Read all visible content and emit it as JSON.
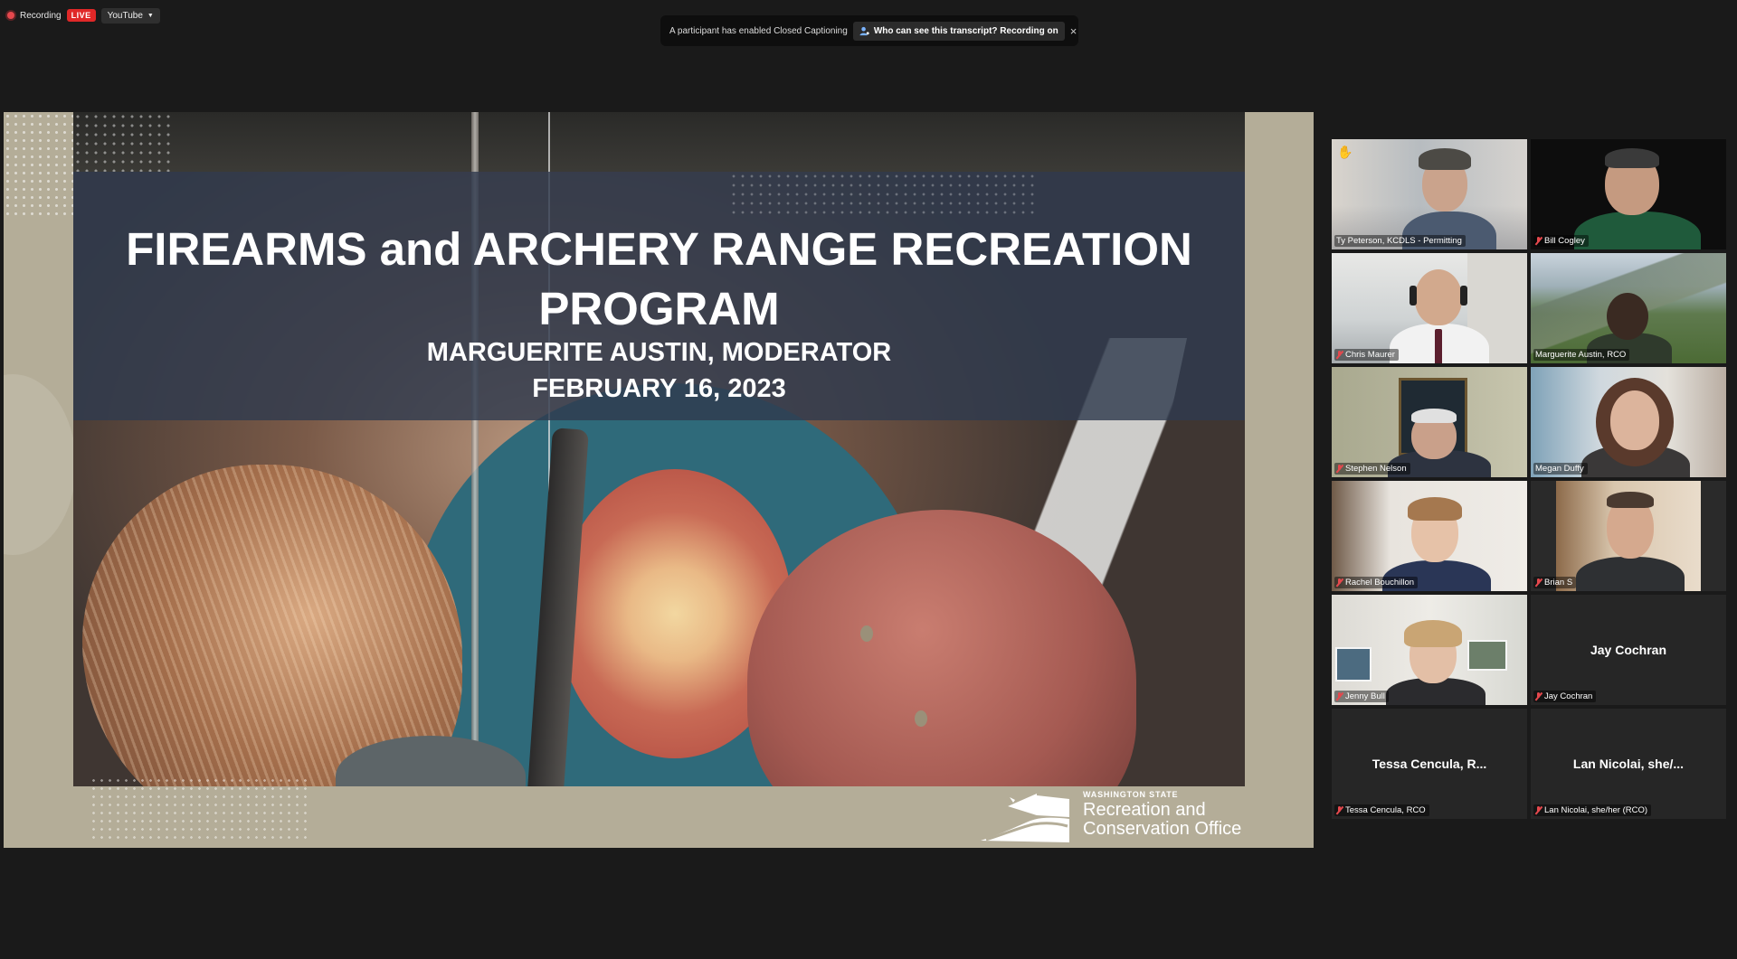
{
  "topbar": {
    "recording_label": "Recording",
    "live_label": "LIVE",
    "stream_target": "YouTube"
  },
  "cc_banner": {
    "message": "A participant has enabled Closed Captioning",
    "link": "Who can see this transcript? Recording on",
    "close": "×"
  },
  "slide": {
    "title": "FIREARMS and ARCHERY RANGE RECREATION PROGRAM",
    "subtitle": "MARGUERITE AUSTIN, MODERATOR",
    "date": "FEBRUARY 16, 2023",
    "logo": {
      "small": "WASHINGTON STATE",
      "line1": "Recreation and",
      "line2": "Conservation Office"
    }
  },
  "participants": [
    {
      "name": "Ty Peterson, KCDLS - Permitting",
      "muted": false,
      "hand_raised": true,
      "video": true,
      "speaking": false
    },
    {
      "name": "Bill Cogley",
      "muted": true,
      "hand_raised": false,
      "video": true,
      "speaking": false
    },
    {
      "name": "Chris Maurer",
      "muted": true,
      "hand_raised": false,
      "video": true,
      "speaking": false
    },
    {
      "name": "Marguerite Austin, RCO",
      "muted": false,
      "hand_raised": false,
      "video": true,
      "speaking": true
    },
    {
      "name": "Stephen Nelson",
      "muted": true,
      "hand_raised": false,
      "video": true,
      "speaking": false
    },
    {
      "name": "Megan Duffy",
      "muted": false,
      "hand_raised": false,
      "video": true,
      "speaking": false
    },
    {
      "name": "Rachel Bouchillon",
      "muted": true,
      "hand_raised": false,
      "video": true,
      "speaking": false
    },
    {
      "name": "Brian S",
      "muted": true,
      "hand_raised": false,
      "video": true,
      "speaking": false
    },
    {
      "name": "Jenny Bull",
      "muted": true,
      "hand_raised": false,
      "video": true,
      "speaking": false
    },
    {
      "name": "Jay Cochran",
      "display_name": "Jay Cochran",
      "muted": true,
      "hand_raised": false,
      "video": false,
      "speaking": false
    },
    {
      "name": "Tessa Cencula, RCO",
      "display_name": "Tessa Cencula, R...",
      "muted": true,
      "hand_raised": false,
      "video": false,
      "speaking": false
    },
    {
      "name": "Lan Nicolai, she/her (RCO)",
      "display_name": "Lan Nicolai, she/...",
      "muted": true,
      "hand_raised": false,
      "video": false,
      "speaking": false
    }
  ],
  "colors": {
    "background": "#1a1a1a",
    "live": "#e02828",
    "speaking_outline": "#c9e26a",
    "muted_icon": "#e5484d",
    "slide_frame": "#b4ad98",
    "title_band": "#303a4e"
  },
  "icons": {
    "recording": "recording-dot-icon",
    "caret": "chevron-down-icon",
    "cc_user": "user-icon",
    "close": "close-icon",
    "hand": "raised-hand-icon",
    "muted": "mic-muted-icon"
  }
}
